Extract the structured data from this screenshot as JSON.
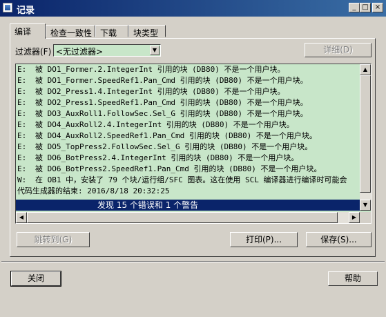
{
  "window": {
    "title": "记录"
  },
  "titlebar": {
    "minimize": "_",
    "maximize": "□",
    "close": "×"
  },
  "tabs": [
    "编译",
    "检查一致性",
    "下载",
    "块类型"
  ],
  "filter": {
    "label": "过滤器(F)",
    "value": "<无过滤器>",
    "details_button": "详细(D)"
  },
  "log": {
    "lines": [
      {
        "prefix": "E:",
        "text": "被 DO1_Former.2.IntegerInt 引用的块 (DB80) 不是一个用户块。"
      },
      {
        "prefix": "E:",
        "text": "被 DO1_Former.SpeedRef1.Pan_Cmd 引用的块 (DB80) 不是一个用户块。"
      },
      {
        "prefix": "E:",
        "text": "被 DO2_Press1.4.IntegerInt 引用的块 (DB80) 不是一个用户块。"
      },
      {
        "prefix": "E:",
        "text": "被 DO2_Press1.SpeedRef1.Pan_Cmd 引用的块 (DB80) 不是一个用户块。"
      },
      {
        "prefix": "E:",
        "text": "被 DO3_AuxRoll1.FollowSec.Sel_G 引用的块 (DB80) 不是一个用户块。"
      },
      {
        "prefix": "E:",
        "text": "被 DO4_AuxRoll2.4.IntegerInt 引用的块 (DB80) 不是一个用户块。"
      },
      {
        "prefix": "E:",
        "text": "被 DO4_AuxRoll2.SpeedRef1.Pan_Cmd 引用的块 (DB80) 不是一个用户块。"
      },
      {
        "prefix": "E:",
        "text": "被 DO5_TopPress2.FollowSec.Sel_G 引用的块 (DB80) 不是一个用户块。"
      },
      {
        "prefix": "E:",
        "text": "被 DO6_BotPress2.4.IntegerInt 引用的块 (DB80) 不是一个用户块。"
      },
      {
        "prefix": "E:",
        "text": "被 DO6_BotPress2.SpeedRef1.Pan_Cmd 引用的块 (DB80) 不是一个用户块。"
      },
      {
        "prefix": "W:",
        "text": "在 OB1 中，安装了 79 个块/运行组/SFC 图表。这在使用 SCL 编译器进行编译时可能会"
      },
      {
        "prefix": "",
        "text": "代码生成器的结束: 2016/8/18 20:32:25"
      }
    ],
    "summary": "发现 15 个错误和 1 个警告"
  },
  "actions": {
    "goto": "跳转到(G)",
    "print": "打印(P)...",
    "save": "保存(S)..."
  },
  "footer": {
    "close": "关闭",
    "help": "帮助"
  }
}
